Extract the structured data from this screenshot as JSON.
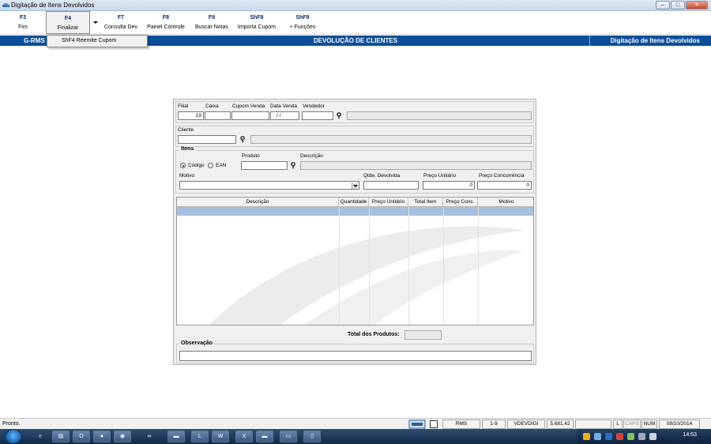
{
  "window": {
    "title": "Digitação de Itens Devolvidos"
  },
  "toolbar": {
    "buttons": [
      {
        "key": "F3",
        "label": "Fim"
      },
      {
        "key": "F4",
        "label": "Finalizar"
      },
      {
        "key": "F7",
        "label": "Consulta Dev"
      },
      {
        "key": "F8",
        "label": "Painel Controle"
      },
      {
        "key": "F9",
        "label": "Buscar Notas"
      },
      {
        "key": "ShF8",
        "label": "Importa Cupom"
      },
      {
        "key": "ShF9",
        "label": "+ Funções"
      }
    ]
  },
  "dropdown": {
    "items": [
      "ShF4 Reemite Cupom"
    ]
  },
  "header": {
    "left": "G-RMS",
    "center": "DEVOLUÇÃO DE CLIENTES",
    "right": "Digitação de Itens Devolvidos"
  },
  "form": {
    "labels": {
      "filial": "Filial",
      "caixa": "Caixa",
      "cupom": "Cupom Venda",
      "data_venda": "Data Venda",
      "vendedor": "Vendedor",
      "cliente": "Cliente",
      "itens": "Itens",
      "produto": "Produto",
      "descricao": "Descrição",
      "codigo": "Código",
      "ean": "EAN",
      "motivo": "Motivo",
      "qtde": "Qtde. Devolvida",
      "preco_unit": "Preço Unitário",
      "preco_conc": "Preço Concorrência",
      "total_produtos": "Total dos Produtos:",
      "observacao": "Observação"
    },
    "values": {
      "filial": "19",
      "data_venda": "/ /",
      "preco_unit": "0",
      "preco_conc": "0"
    },
    "radio_selected": "codigo"
  },
  "grid": {
    "columns": [
      "Descrição",
      "Quantidade",
      "Preço Unitário",
      "Total Item",
      "Preço Conc.",
      "Motivo"
    ]
  },
  "status": {
    "message": "Pronto.",
    "panels": [
      "RMS",
      "1-9",
      "VDEVDIGI",
      "5.681.42",
      "L",
      "CAPS",
      "NUM",
      "08/10/2014"
    ]
  },
  "taskbar": {
    "clock": "14:53"
  }
}
